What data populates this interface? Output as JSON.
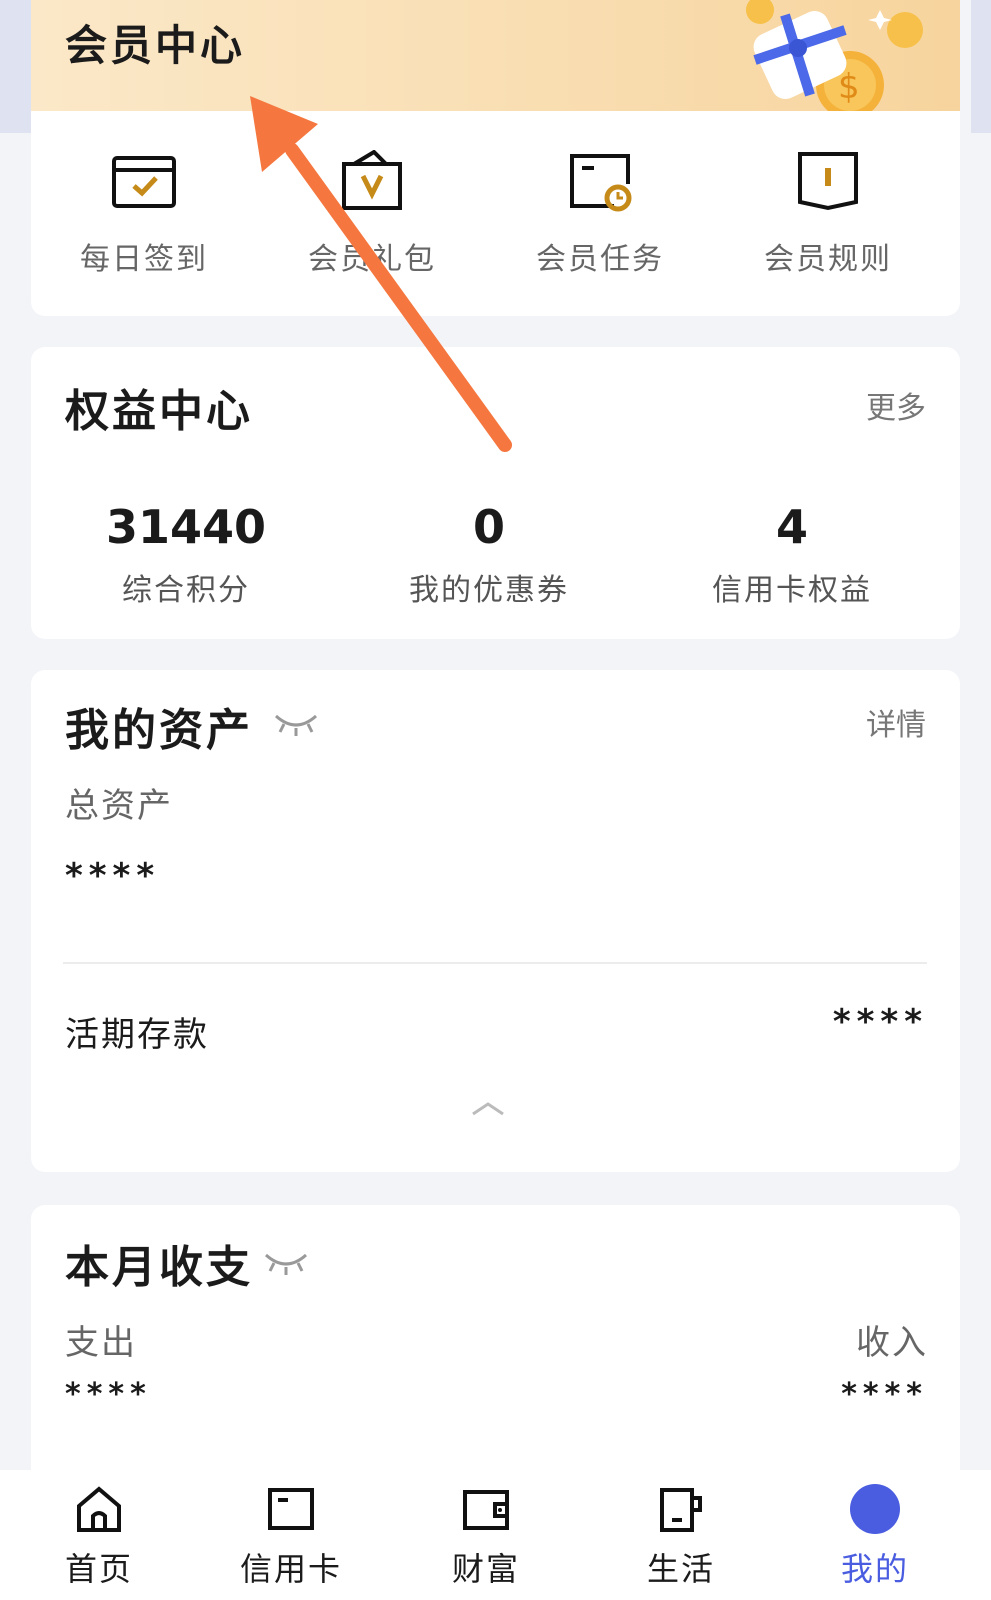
{
  "member": {
    "title": "会员中心",
    "quick_actions": [
      {
        "label": "每日签到",
        "icon": "calendar-check-icon"
      },
      {
        "label": "会员礼包",
        "icon": "gift-bag-icon"
      },
      {
        "label": "会员任务",
        "icon": "task-clock-icon"
      },
      {
        "label": "会员规则",
        "icon": "rule-book-icon"
      }
    ]
  },
  "rights": {
    "title": "权益中心",
    "more_label": "更多",
    "stats": [
      {
        "value": "31440",
        "caption": "综合积分"
      },
      {
        "value": "0",
        "caption": "我的优惠券"
      },
      {
        "value": "4",
        "caption": "信用卡权益"
      }
    ]
  },
  "assets": {
    "title": "我的资产",
    "detail_label": "详情",
    "total_label": "总资产",
    "total_value": "****",
    "demand_label": "活期存款",
    "demand_value": "****"
  },
  "monthly": {
    "title": "本月收支",
    "expense_label": "支出",
    "income_label": "收入",
    "expense_value": "****",
    "income_value": "****"
  },
  "tabs": [
    {
      "label": "首页",
      "icon": "home-icon"
    },
    {
      "label": "信用卡",
      "icon": "credit-card-icon"
    },
    {
      "label": "财富",
      "icon": "wallet-icon"
    },
    {
      "label": "生活",
      "icon": "cup-icon"
    },
    {
      "label": "我的",
      "icon": "profile-icon",
      "active": true
    }
  ],
  "colors": {
    "accent": "#4a5de0",
    "gold": "#c58a18",
    "arrow": "#f5773f"
  }
}
